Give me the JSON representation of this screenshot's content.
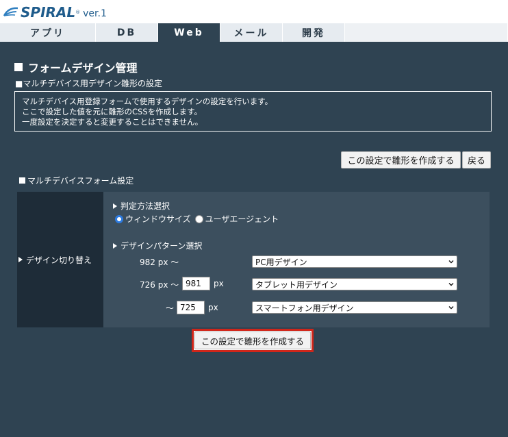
{
  "header": {
    "logo_text": "SPIRAL",
    "logo_reg": "®",
    "version": "ver.1"
  },
  "tabs": [
    {
      "label": "アプリ",
      "active": false
    },
    {
      "label": "DB",
      "active": false
    },
    {
      "label": "Web",
      "active": true
    },
    {
      "label": "メール",
      "active": false
    },
    {
      "label": "開発",
      "active": false
    }
  ],
  "page": {
    "title": "フォームデザイン管理",
    "subtitle": "■マルチデバイス用デザイン雛形の設定",
    "info_lines": [
      "マルチデバイス用登録フォームで使用するデザインの設定を行います。",
      "ここで設定した値を元に雛形のCSSを作成します。",
      "一度設定を決定すると変更することはできません。"
    ]
  },
  "actions": {
    "create_top": "この設定で雛形を作成する",
    "back": "戻る",
    "create_main": "この設定で雛形を作成する"
  },
  "form": {
    "section_title": "マルチデバイスフォーム設定",
    "row_label": "デザイン切り替え",
    "judge_method": {
      "title": "判定方法選択",
      "options": [
        "ウィンドウサイズ",
        "ユーザエージェント"
      ],
      "selected": "ウィンドウサイズ"
    },
    "pattern": {
      "title": "デザインパターン選択",
      "rows": [
        {
          "prefix": "982 px 〜",
          "select": "PC用デザイン"
        },
        {
          "prefix": "726 px 〜",
          "input": "981",
          "suffix": "px",
          "select": "タブレット用デザイン"
        },
        {
          "prefix": "〜",
          "input": "725",
          "suffix": "px",
          "select": "スマートフォン用デザイン"
        }
      ]
    }
  },
  "colors": {
    "background": "#2f4352",
    "highlight": "#d0261a",
    "radio_selected": "#2d7be0"
  }
}
